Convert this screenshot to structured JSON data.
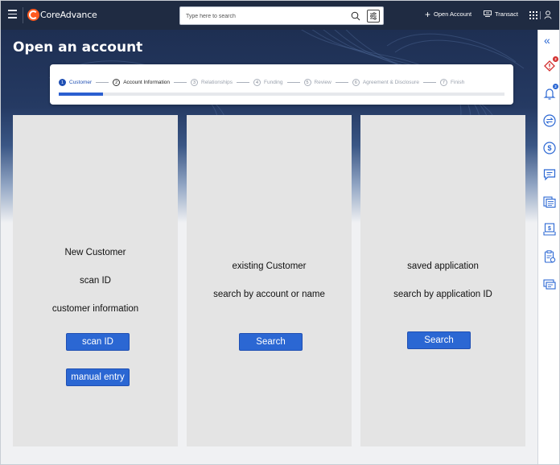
{
  "header": {
    "brand": "CoreAdvance",
    "search_placeholder": "Type here to search",
    "open_account_label": "Open Account",
    "transact_label": "Transact"
  },
  "page": {
    "title": "Open an account"
  },
  "stepper": {
    "steps": [
      {
        "num": "1",
        "label": "Customer",
        "state": "active"
      },
      {
        "num": "2",
        "label": "Account Information",
        "state": "done"
      },
      {
        "num": "3",
        "label": "Relationships",
        "state": "pending"
      },
      {
        "num": "4",
        "label": "Funding",
        "state": "pending"
      },
      {
        "num": "5",
        "label": "Review",
        "state": "pending"
      },
      {
        "num": "6",
        "label": "Agreement & Disclosure",
        "state": "pending"
      },
      {
        "num": "7",
        "label": "Finish",
        "state": "pending"
      }
    ],
    "progress_fraction": 0.1
  },
  "cards": {
    "new_customer": {
      "heading": "New Customer",
      "line2": "scan ID",
      "line3": "customer information",
      "scan_button": "scan ID",
      "manual_button": "manual entry"
    },
    "existing_customer": {
      "heading": "existing Customer",
      "line2": "search by account or name",
      "search_button": "Search"
    },
    "saved_application": {
      "heading": "saved application",
      "line2": "search by application ID",
      "search_button": "Search"
    }
  },
  "rail": {
    "icons": [
      "collapse-icon",
      "alert-tag-icon",
      "notification-bell-icon",
      "transfer-icon",
      "dollar-circle-icon",
      "chat-icon",
      "documents-icon",
      "statement-icon",
      "clipboard-icon",
      "id-card-icon"
    ],
    "alert_badge": "2",
    "bell_badge": "2",
    "accent": "#2b67d3",
    "alert_color": "#d32f2f"
  }
}
